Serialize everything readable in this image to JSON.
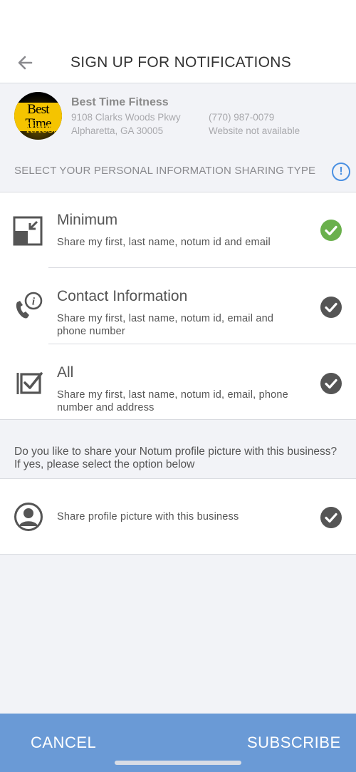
{
  "header": {
    "title": "SIGN UP FOR NOTIFICATIONS",
    "back_icon": "arrow-left-icon"
  },
  "business": {
    "logo_text_top": "Best Time",
    "logo_text_bottom": "Fitness",
    "name": "Best Time Fitness",
    "address_line1": "9108 Clarks Woods Pkwy",
    "address_line2": "Alpharetta,  GA 30005",
    "phone": "(770) 987-0079",
    "website": "Website not available"
  },
  "sharing": {
    "section_label": "SELECT YOUR PERSONAL INFORMATION SHARING TYPE",
    "info_icon_glyph": "!",
    "options": [
      {
        "title": "Minimum",
        "description": "Share my first, last name, notum id and email",
        "icon": "minimize-icon",
        "selected": true
      },
      {
        "title": "Contact Information",
        "description": "Share my first, last name, notum id, email and phone number",
        "icon": "phone-info-icon",
        "selected": false
      },
      {
        "title": "All",
        "description": "Share my first, last name, notum id, email, phone number and address",
        "icon": "checkbox-icon",
        "selected": false
      }
    ]
  },
  "profile": {
    "question": "Do you like to share your Notum profile picture with this business? If yes, please select the option below",
    "label": "Share profile picture with this business",
    "selected": false
  },
  "footer": {
    "cancel_label": "CANCEL",
    "subscribe_label": "SUBSCRIBE"
  },
  "colors": {
    "accent_blue": "#4a90e2",
    "footer_blue": "#6a9ad6",
    "check_green": "#6ab04c",
    "check_gray": "#555555"
  }
}
